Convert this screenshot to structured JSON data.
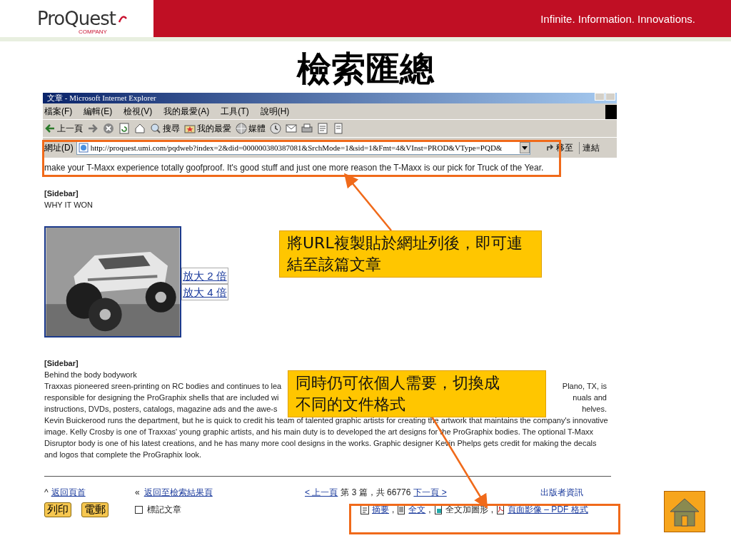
{
  "slide": {
    "logo": {
      "name": "ProQuest",
      "sub": "COMPANY"
    },
    "tagline": "Infinite. Information. Innovations.",
    "title": "檢索匯總"
  },
  "browser": {
    "title": "文章 - Microsoft Internet Explorer",
    "menu": [
      "檔案(F)",
      "編輯(E)",
      "檢視(V)",
      "我的最愛(A)",
      "工具(T)",
      "說明(H)"
    ],
    "toolbar": [
      {
        "label": "上一頁",
        "kind": "back"
      },
      {
        "kind": "forward"
      },
      {
        "kind": "stop"
      },
      {
        "kind": "refresh"
      },
      {
        "kind": "home"
      },
      {
        "label": "搜尋",
        "kind": "search"
      },
      {
        "label": "我的最愛",
        "kind": "favorites"
      },
      {
        "label": "媒體",
        "kind": "media"
      },
      {
        "kind": "history"
      },
      {
        "kind": "mail"
      },
      {
        "kind": "print"
      },
      {
        "kind": "edit"
      },
      {
        "kind": "discuss"
      }
    ],
    "address_label": "網址(D)",
    "url": "http://proquest.umi.com/pqdweb?index=2&did=000000380387081&SrchMode=1&sid=1&Fmt=4&VInst=PROD&VType=PQD&",
    "go": "移至",
    "links": "連結"
  },
  "article": {
    "intro": "make your T-Maxx experience totally goofproof. It's good stuff and just one more reason the T-Maxx is our pick for Truck of the Year.",
    "sidebar1": {
      "heading": "[Sidebar]",
      "subtitle": "WHY IT WON"
    },
    "image": {
      "kind": "picture",
      "links": [
        "放大 2 倍",
        "放大 4 倍"
      ]
    },
    "sidebar2": {
      "heading": "[Sidebar]",
      "subtitle": "Behind the body bodywork",
      "partial_lines": [
        {
          "left": "Traxxas pioneered sreen-printing on RC bodies and continues to lea",
          "right": "Plano, TX, is"
        },
        {
          "left": "responsible for designing the ProGraphix shells that are included wi",
          "right": "nuals and"
        },
        {
          "left": "instructions, DVDs, posters, catalogs, magazine ads and the awe-s",
          "right": "helves."
        }
      ],
      "rest": "Kevin Buickerood runs the department, but he is quick to credit his team of talented graphic artists for creating the artwork that maintains the company's innovative image. Kelly Crosby is one of Traxxas' young graphic artists, and his main duty is to developed the art designs for the ProGraphix bodies. The optional T-Maxx Disruptor body is one of his latest creations, and he has many more cool designs in the works. Graphic designer Kevin Phelps gets credit for making the decals and logos that complete the ProGraphix look."
    }
  },
  "footer": {
    "top_mark": "^",
    "top_link": "返回頁首",
    "back_mark": "«",
    "back_link": "返回至檢索結果頁",
    "prev": "< 上一頁",
    "position": "第 3 篇，共 66776",
    "next": "下一頁 >",
    "publisher": "出版者資訊",
    "buttons": [
      "列印",
      "電郵"
    ],
    "mark_article": {
      "label": "標記文章",
      "checked": false
    },
    "formats": [
      {
        "label": "摘要",
        "kind": "link",
        "sep": ","
      },
      {
        "label": "全文",
        "kind": "link",
        "sep": ","
      },
      {
        "label": "全文加圖形",
        "kind": "text",
        "sep": ","
      },
      {
        "label": "頁面影像 – PDF 格式",
        "kind": "link"
      }
    ]
  },
  "callouts": [
    {
      "text": "將URL複製貼於網址列後，即可連結至該篇文章"
    },
    {
      "text": "同時仍可依個人需要，切換成不同的文件格式"
    }
  ]
}
